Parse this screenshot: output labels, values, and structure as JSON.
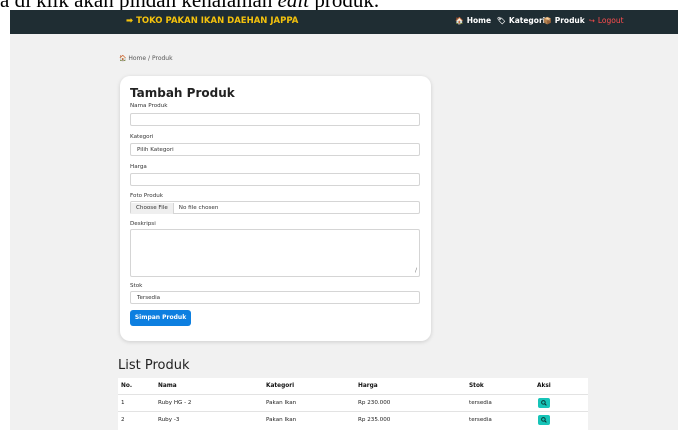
{
  "caption": {
    "text_main": "a di klik akan pindah kehalaman ",
    "text_italic": "edit",
    "text_tail": " produk."
  },
  "navbar": {
    "brand": "➡ TOKO PAKAN IKAN DAEHAN JAPPA",
    "items": [
      {
        "label": "Home",
        "icon": "home-icon",
        "glyph": "🏠"
      },
      {
        "label": "Kategori",
        "icon": "tag-icon",
        "glyph": "🏷"
      },
      {
        "label": "Produk",
        "icon": "boxes-icon",
        "glyph": "📦"
      },
      {
        "label": "Logout",
        "icon": "logout-icon",
        "glyph": "↪"
      }
    ]
  },
  "breadcrumb": {
    "home": "🏠 Home",
    "sep": "/",
    "current": "Produk"
  },
  "form": {
    "title": "Tambah Produk",
    "nama_label": "Nama Produk",
    "nama_value": "",
    "kategori_label": "Kategori",
    "kategori_value": "Pilih Kategori",
    "harga_label": "Harga",
    "harga_value": "",
    "foto_label": "Foto Produk",
    "foto_button": "Choose File",
    "foto_status": "No file chosen",
    "deskripsi_label": "Deskripsi",
    "stok_label": "Stok",
    "stok_value": "Tersedia",
    "submit": "Simpan Produk"
  },
  "list": {
    "title": "List Produk",
    "headers": [
      "No.",
      "Nama",
      "Kategori",
      "Harga",
      "Stok",
      "Aksi"
    ],
    "rows": [
      {
        "no": "1",
        "nama": "Ruby HG - 2",
        "kategori": "Pakan Ikan",
        "harga": "Rp 230.000",
        "stok": "tersedia"
      },
      {
        "no": "2",
        "nama": "Ruby -3",
        "kategori": "Pakan Ikan",
        "harga": "Rp 235.000",
        "stok": "tersedia"
      }
    ]
  },
  "colors": {
    "navbar": "#1f2d33",
    "brand": "#f4c20d",
    "primary": "#0d7fe0",
    "action": "#17c4b8",
    "logout": "#ff4d4d"
  }
}
